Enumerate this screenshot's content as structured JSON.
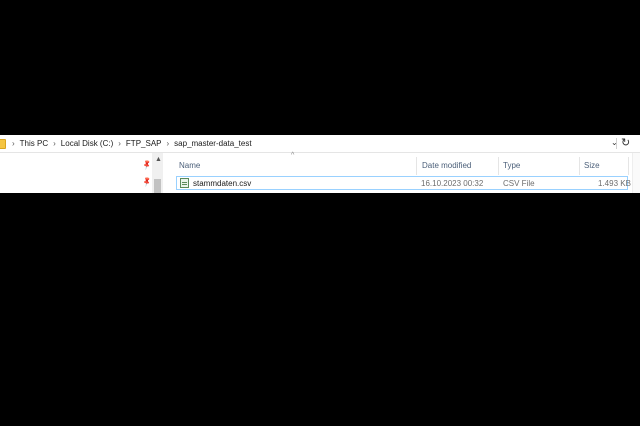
{
  "address_bar": {
    "breadcrumbs": [
      "This PC",
      "Local Disk (C:)",
      "FTP_SAP",
      "sap_master-data_test"
    ],
    "separator": "›",
    "dropdown_glyph": "⌄",
    "refresh_glyph": "↻"
  },
  "nav_pane": {
    "pin_glyph": "📌",
    "scroll_up_glyph": "▲"
  },
  "file_list": {
    "sort_indicator": "^",
    "columns": {
      "name": "Name",
      "date_modified": "Date modified",
      "type": "Type",
      "size": "Size"
    },
    "rows": [
      {
        "name": "stammdaten.csv",
        "date_modified": "16.10.2023 00:32",
        "type": "CSV File",
        "size": "1.493 KB"
      }
    ]
  },
  "colors": {
    "selection_border": "#99d1ff",
    "header_text": "#4c607a",
    "background": "#000000"
  }
}
